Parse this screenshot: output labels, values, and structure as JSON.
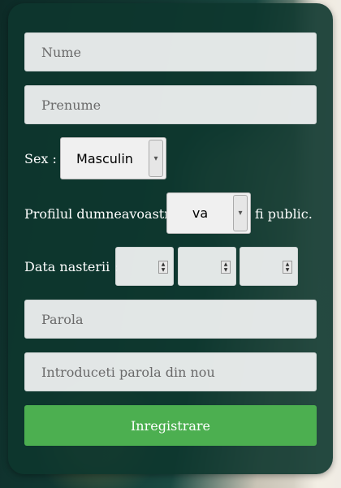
{
  "form": {
    "nume_placeholder": "Nume",
    "prenume_placeholder": "Prenume",
    "sex_label": "Sex :",
    "sex_selected": "Masculin",
    "profile_prefix": "Profilul dumneavoastra",
    "profile_selected": "va",
    "profile_suffix": "fi public.",
    "birthdate_label": "Data nasterii :",
    "parola_placeholder": "Parola",
    "confirm_placeholder": "Introduceti parola din nou",
    "submit_label": "Inregistrare"
  },
  "icons": {
    "select_arrow": "chevron-down-icon",
    "spinner": "spinner-icon"
  },
  "colors": {
    "panel": "#0d362e",
    "button": "#4caf50"
  }
}
